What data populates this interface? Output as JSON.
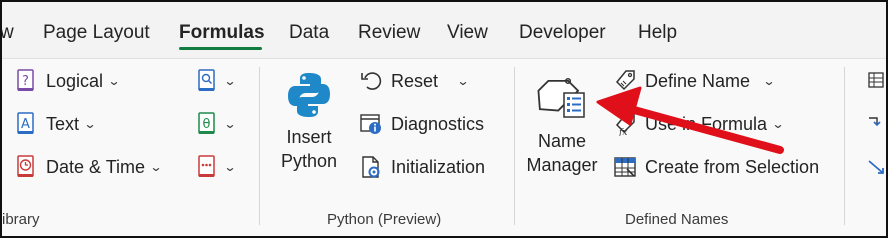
{
  "tabs": [
    {
      "label": "w"
    },
    {
      "label": "Page Layout"
    },
    {
      "label": "Formulas"
    },
    {
      "label": "Data"
    },
    {
      "label": "Review"
    },
    {
      "label": "View"
    },
    {
      "label": "Developer"
    },
    {
      "label": "Help"
    }
  ],
  "active_tab": "Formulas",
  "library": {
    "logical": "Logical",
    "text": "Text",
    "date_time": "Date & Time",
    "group_label": "ibrary"
  },
  "python": {
    "insert_line1": "Insert",
    "insert_line2": "Python",
    "reset": "Reset",
    "diagnostics": "Diagnostics",
    "initialization": "Initialization",
    "group_label": "Python (Preview)"
  },
  "defined_names": {
    "name_manager_line1": "Name",
    "name_manager_line2": "Manager",
    "define_name": "Define Name",
    "use_in_formula": "Use in Formula",
    "create_from_selection": "Create from Selection",
    "group_label": "Defined Names"
  },
  "colors": {
    "accent_green": "#107c41",
    "annotation_red": "#e0101a",
    "icon_blue": "#2b6cc4"
  }
}
